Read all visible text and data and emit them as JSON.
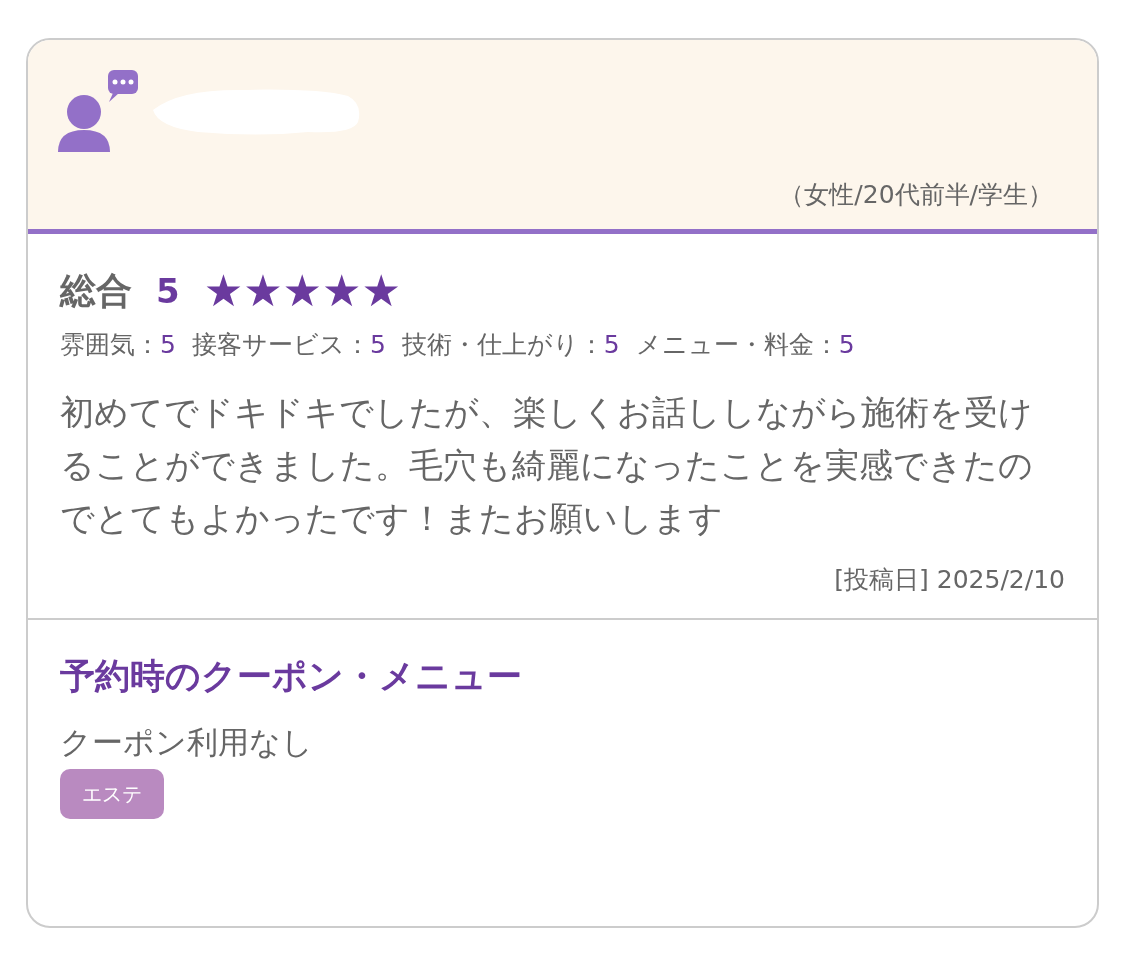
{
  "reviewer": {
    "profile": "（女性/20代前半/学生）"
  },
  "overall": {
    "label": "総合",
    "score": "5",
    "stars": 5
  },
  "ratings": [
    {
      "label": "雰囲気：",
      "value": "5"
    },
    {
      "label": "接客サービス：",
      "value": "5"
    },
    {
      "label": "技術・仕上がり：",
      "value": "5"
    },
    {
      "label": "メニュー・料金：",
      "value": "5"
    }
  ],
  "comment": "初めてでドキドキでしたが、楽しくお話ししながら施術を受けることができました。毛穴も綺麗になったことを実感できたのでとてもよかったです！またお願いします",
  "posted": "[投稿日] 2025/2/10",
  "coupon": {
    "heading": "予約時のクーポン・メニュー",
    "text": "クーポン利用なし",
    "tags": [
      "エステ"
    ]
  }
}
